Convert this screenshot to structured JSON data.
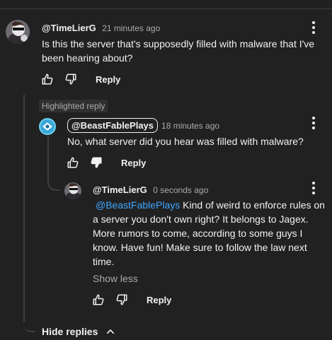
{
  "comment": {
    "handle": "@TimeLierG",
    "time": "21 minutes ago",
    "text_line1": "Is this the server that's supposedly filled with malware that I've",
    "text_line2": "been hearing about?",
    "reply_label": "Reply",
    "icons": {
      "like": "thumbs-up-icon",
      "dislike": "thumbs-down-icon",
      "menu": "more-vert-icon"
    }
  },
  "highlighted_badge": "Highlighted reply",
  "reply1": {
    "handle": "@BeastFablePlays",
    "time": "18 minutes ago",
    "text": "No, what server did you hear was filled with malware?",
    "reply_label": "Reply"
  },
  "reply2": {
    "handle": "@TimeLierG",
    "time": "0 seconds ago",
    "mention": "@BeastFablePlays",
    "text_line1": " Kind of weird to enforce rules on",
    "text_line2": "a server you don't own right? It belongs to Jagex.",
    "text_line3": "More rumors to come, according to some guys I",
    "text_line4": "know. Have fun! Make sure to follow the law next",
    "text_line5": "time.",
    "show_less": "Show less",
    "reply_label": "Reply"
  },
  "hide_replies": "Hide replies",
  "colors": {
    "background": "#212121",
    "text": "#f1f1f1",
    "secondary": "#aaaaaa",
    "link": "#3ea6ff",
    "thread": "#3f3f3f"
  }
}
